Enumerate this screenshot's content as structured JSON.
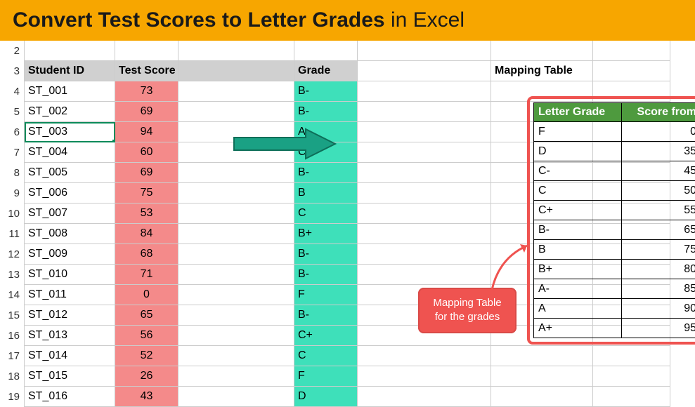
{
  "title": {
    "bold": "Convert Test Scores to Letter Grades",
    "rest": " in Excel"
  },
  "row_numbers": [
    "2",
    "3",
    "4",
    "5",
    "6",
    "7",
    "8",
    "9",
    "10",
    "11",
    "12",
    "13",
    "14",
    "15",
    "16",
    "17",
    "18",
    "19"
  ],
  "headers": {
    "student": "Student ID",
    "score": "Test Score",
    "grade": "Grade",
    "mapping": "Mapping Table"
  },
  "students": [
    {
      "id": "ST_001",
      "score": "73",
      "grade": "B-"
    },
    {
      "id": "ST_002",
      "score": "69",
      "grade": "B-"
    },
    {
      "id": "ST_003",
      "score": "94",
      "grade": "A"
    },
    {
      "id": "ST_004",
      "score": "60",
      "grade": "C+"
    },
    {
      "id": "ST_005",
      "score": "69",
      "grade": "B-"
    },
    {
      "id": "ST_006",
      "score": "75",
      "grade": "B"
    },
    {
      "id": "ST_007",
      "score": "53",
      "grade": "C"
    },
    {
      "id": "ST_008",
      "score": "84",
      "grade": "B+"
    },
    {
      "id": "ST_009",
      "score": "68",
      "grade": "B-"
    },
    {
      "id": "ST_010",
      "score": "71",
      "grade": "B-"
    },
    {
      "id": "ST_011",
      "score": "0",
      "grade": "F"
    },
    {
      "id": "ST_012",
      "score": "65",
      "grade": "B-"
    },
    {
      "id": "ST_013",
      "score": "56",
      "grade": "C+"
    },
    {
      "id": "ST_014",
      "score": "52",
      "grade": "C"
    },
    {
      "id": "ST_015",
      "score": "26",
      "grade": "F"
    },
    {
      "id": "ST_016",
      "score": "43",
      "grade": "D"
    }
  ],
  "selected_row_index": 2,
  "mapping": {
    "header_grade": "Letter Grade",
    "header_score": "Score from",
    "rows": [
      {
        "g": "F",
        "s": "0"
      },
      {
        "g": "D",
        "s": "35"
      },
      {
        "g": "C-",
        "s": "45"
      },
      {
        "g": "C",
        "s": "50"
      },
      {
        "g": "C+",
        "s": "55"
      },
      {
        "g": "B-",
        "s": "65"
      },
      {
        "g": "B",
        "s": "75"
      },
      {
        "g": "B+",
        "s": "80"
      },
      {
        "g": "A-",
        "s": "85"
      },
      {
        "g": "A",
        "s": "90"
      },
      {
        "g": "A+",
        "s": "95"
      }
    ]
  },
  "callout": {
    "line1": "Mapping Table",
    "line2": "for the grades"
  },
  "colors": {
    "accent_orange": "#f7a600",
    "score_bg": "#f48a8a",
    "grade_bg": "#3ee0ba",
    "mapping_header": "#4e9a3e",
    "callout": "#ef5350",
    "arrow": "#1aa184"
  }
}
